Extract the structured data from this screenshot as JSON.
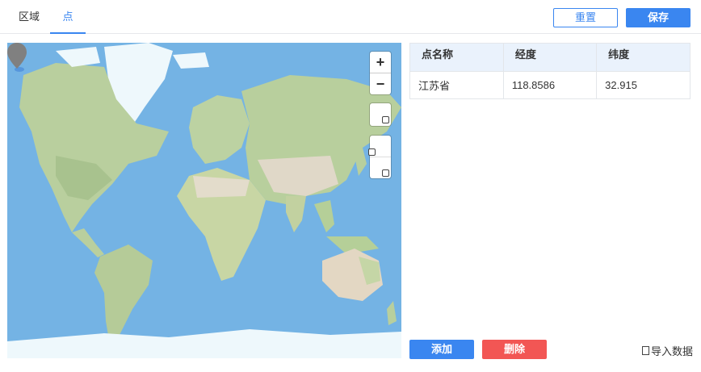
{
  "tabs": [
    {
      "label": "区域",
      "active": false
    },
    {
      "label": "点",
      "active": true
    }
  ],
  "toolbar": {
    "reset_label": "重置",
    "save_label": "保存"
  },
  "map": {
    "zoom_in": "+",
    "zoom_out": "−",
    "marker_location": {
      "name": "江苏省",
      "lng": 118.8586,
      "lat": 32.915
    }
  },
  "table": {
    "headers": [
      "点名称",
      "经度",
      "纬度"
    ],
    "rows": [
      [
        "江苏省",
        "118.8586",
        "32.915"
      ]
    ]
  },
  "actions": {
    "add_label": "添加",
    "delete_label": "删除",
    "import_label": "导入数据"
  },
  "colors": {
    "accent": "#3a86f0",
    "danger": "#f25654",
    "ocean": "#74b3e4",
    "land": "#b5cfa0",
    "ice": "#eef8fc"
  }
}
